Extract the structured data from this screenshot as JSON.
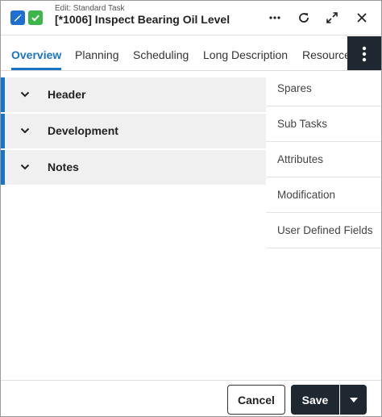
{
  "header": {
    "subtitle": "Edit: Standard Task",
    "title": "[*1006] Inspect Bearing Oil Level",
    "icons": [
      "edit-icon",
      "check-icon",
      "more-horizontal-icon",
      "refresh-icon",
      "expand-icon",
      "close-icon"
    ]
  },
  "tabs": [
    {
      "label": "Overview",
      "active": true
    },
    {
      "label": "Planning"
    },
    {
      "label": "Scheduling"
    },
    {
      "label": "Long Description"
    },
    {
      "label": "Resources"
    }
  ],
  "sections": [
    {
      "label": "Header"
    },
    {
      "label": "Development"
    },
    {
      "label": "Notes"
    }
  ],
  "side_items": [
    {
      "label": "Spares"
    },
    {
      "label": "Sub Tasks"
    },
    {
      "label": "Attributes"
    },
    {
      "label": "Modification"
    },
    {
      "label": "User Defined Fields"
    }
  ],
  "footer": {
    "cancel_label": "Cancel",
    "save_label": "Save"
  },
  "colors": {
    "accent": "#1a73c4",
    "dark": "#1f2730",
    "edit_icon_bg": "#1f6fd1",
    "check_icon_bg": "#3cb64a",
    "section_bg": "#f0f0f0"
  }
}
